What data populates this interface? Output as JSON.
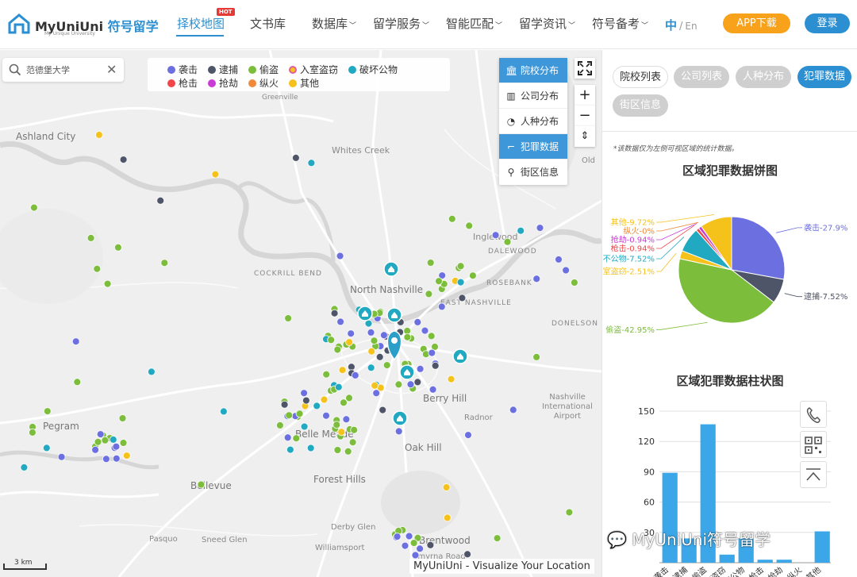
{
  "header": {
    "brand_en": "MyUniUni",
    "brand_cn": "符号留学",
    "brand_sub": "My Unique University",
    "nav": [
      {
        "label": "择校地图",
        "active": true,
        "caret": false
      },
      {
        "label": "文书库",
        "active": false,
        "caret": false
      },
      {
        "label": "数据库",
        "active": false,
        "caret": true
      },
      {
        "label": "留学服务",
        "active": false,
        "caret": true
      },
      {
        "label": "智能匹配",
        "active": false,
        "caret": true
      },
      {
        "label": "留学资讯",
        "active": false,
        "caret": true
      },
      {
        "label": "符号备考",
        "active": false,
        "caret": true
      }
    ],
    "hot_badge": "HOT",
    "lang_zh": "中",
    "lang_sep": "/",
    "lang_en": "En",
    "app_button": "APP下载",
    "login_button": "登录"
  },
  "map": {
    "search": {
      "value": "范德堡大学"
    },
    "legend": [
      {
        "label": "袭击",
        "color": "#6c6fe0"
      },
      {
        "label": "逮捕",
        "color": "#4f5568"
      },
      {
        "label": "偷盗",
        "color": "#7cbd3b"
      },
      {
        "label": "入室盗窃",
        "color": "#f5c21b"
      },
      {
        "label": "破坏公物",
        "color": "#21a9c2"
      },
      {
        "label": "枪击",
        "color": "#f0464a"
      },
      {
        "label": "抢劫",
        "color": "#c93cd6"
      },
      {
        "label": "纵火",
        "color": "#f08a3a"
      },
      {
        "label": "其他",
        "color": "#f5c21b"
      }
    ],
    "layers": [
      {
        "label": "院校分布",
        "icon": "university-icon",
        "active": true
      },
      {
        "label": "公司分布",
        "icon": "building-icon",
        "active": false
      },
      {
        "label": "人种分布",
        "icon": "pie-icon",
        "active": false
      },
      {
        "label": "犯罪数据",
        "icon": "gun-icon",
        "active": true
      },
      {
        "label": "街区信息",
        "icon": "signpost-icon",
        "active": false
      }
    ],
    "zoom_in": "+",
    "zoom_out": "−",
    "compass": "⇕",
    "places": [
      "Ashland City",
      "Whites Creek",
      "Greenville",
      "Inglewood",
      "DALEWOOD",
      "ROSEBANK",
      "North Nashville",
      "EAST NASHVILLE",
      "COCKRILL BEND",
      "DONELSON",
      "Berry Hill",
      "Radnor",
      "Pegram",
      "Bellevue",
      "Belle Meade",
      "Oak Hill",
      "Forest Hills",
      "Nashville International Airport",
      "Brentwood",
      "Derby Glen",
      "Pasquo",
      "Sneed Glen",
      "Williamsport",
      "Smyrna Road",
      "Old"
    ],
    "scale_label": "3 km",
    "attribution": "MyUniUni - Visualize Your Location"
  },
  "panel": {
    "tabs": [
      {
        "label": "院校列表",
        "style": "outline"
      },
      {
        "label": "公司列表",
        "style": "grey"
      },
      {
        "label": "人种分布",
        "style": "grey"
      },
      {
        "label": "犯罪数据",
        "style": "active"
      },
      {
        "label": "街区信息",
        "style": "grey"
      }
    ],
    "note": "*该数据仅为左侧可视区域的统计数据。",
    "pie_title": "区域犯罪数据饼图",
    "bar_title": "区域犯罪数据柱状图",
    "watermark": "MyUniUni符号留学"
  },
  "chart_data": [
    {
      "type": "pie",
      "title": "区域犯罪数据饼图",
      "slices": [
        {
          "label": "袭击",
          "value": 27.9,
          "text": "袭击-27.9%",
          "color": "#6c6fe0"
        },
        {
          "label": "逮捕",
          "value": 7.52,
          "text": "逮捕-7.52%",
          "color": "#4f5568"
        },
        {
          "label": "偷盗",
          "value": 42.95,
          "text": "偷盗-42.95%",
          "color": "#7cbd3b"
        },
        {
          "label": "入室盗窃",
          "value": 2.51,
          "text": "室盗窃-2.51%",
          "color": "#f5c21b"
        },
        {
          "label": "破坏公物",
          "value": 7.52,
          "text": "不公物-7.52%",
          "color": "#21a9c2"
        },
        {
          "label": "枪击",
          "value": 0.94,
          "text": "枪击-0.94%",
          "color": "#f0464a"
        },
        {
          "label": "抢劫",
          "value": 0.94,
          "text": "抢劫-0.94%",
          "color": "#c93cd6"
        },
        {
          "label": "纵火",
          "value": 0,
          "text": "纵火-0%",
          "color": "#f08a3a"
        },
        {
          "label": "其他",
          "value": 9.72,
          "text": "其他-9.72%",
          "color": "#f5c21b"
        }
      ]
    },
    {
      "type": "bar",
      "title": "区域犯罪数据柱状图",
      "categories": [
        "袭击",
        "逮捕",
        "偷盗",
        "入室盗窃",
        "破坏公物",
        "枪击",
        "抢劫",
        "纵火",
        "其他"
      ],
      "values": [
        89,
        24,
        137,
        8,
        24,
        3,
        3,
        0,
        31
      ],
      "ylim": [
        0,
        150
      ],
      "yticks": [
        30,
        60,
        90,
        120,
        150
      ],
      "color": "#3ba7e8",
      "grid": true
    }
  ]
}
